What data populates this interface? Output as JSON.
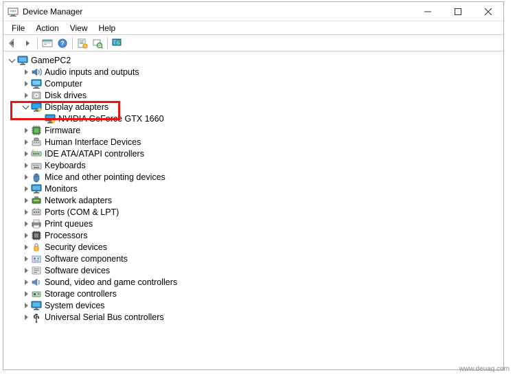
{
  "window": {
    "title": "Device Manager"
  },
  "menubar": [
    "File",
    "Action",
    "View",
    "Help"
  ],
  "tree": {
    "root": "GamePC2",
    "root_expanded": true,
    "categories": [
      {
        "label": "Audio inputs and outputs",
        "icon": "audio-icon",
        "expanded": false
      },
      {
        "label": "Computer",
        "icon": "computer-icon",
        "expanded": false
      },
      {
        "label": "Disk drives",
        "icon": "disk-icon",
        "expanded": false
      },
      {
        "label": "Display adapters",
        "icon": "display-icon",
        "expanded": true,
        "highlight": true,
        "children": [
          {
            "label": "NVIDIA GeForce GTX 1660",
            "icon": "display-icon"
          }
        ]
      },
      {
        "label": "Firmware",
        "icon": "firmware-icon",
        "expanded": false
      },
      {
        "label": "Human Interface Devices",
        "icon": "hid-icon",
        "expanded": false
      },
      {
        "label": "IDE ATA/ATAPI controllers",
        "icon": "ide-icon",
        "expanded": false
      },
      {
        "label": "Keyboards",
        "icon": "keyboard-icon",
        "expanded": false
      },
      {
        "label": "Mice and other pointing devices",
        "icon": "mouse-icon",
        "expanded": false
      },
      {
        "label": "Monitors",
        "icon": "monitor-icon",
        "expanded": false
      },
      {
        "label": "Network adapters",
        "icon": "network-icon",
        "expanded": false
      },
      {
        "label": "Ports (COM & LPT)",
        "icon": "ports-icon",
        "expanded": false
      },
      {
        "label": "Print queues",
        "icon": "printer-icon",
        "expanded": false
      },
      {
        "label": "Processors",
        "icon": "cpu-icon",
        "expanded": false
      },
      {
        "label": "Security devices",
        "icon": "security-icon",
        "expanded": false
      },
      {
        "label": "Software components",
        "icon": "swcomp-icon",
        "expanded": false
      },
      {
        "label": "Software devices",
        "icon": "swdev-icon",
        "expanded": false
      },
      {
        "label": "Sound, video and game controllers",
        "icon": "sound-icon",
        "expanded": false
      },
      {
        "label": "Storage controllers",
        "icon": "storage-icon",
        "expanded": false
      },
      {
        "label": "System devices",
        "icon": "system-icon",
        "expanded": false
      },
      {
        "label": "Universal Serial Bus controllers",
        "icon": "usb-icon",
        "expanded": false
      }
    ]
  },
  "watermark": "www.deuaq.com"
}
